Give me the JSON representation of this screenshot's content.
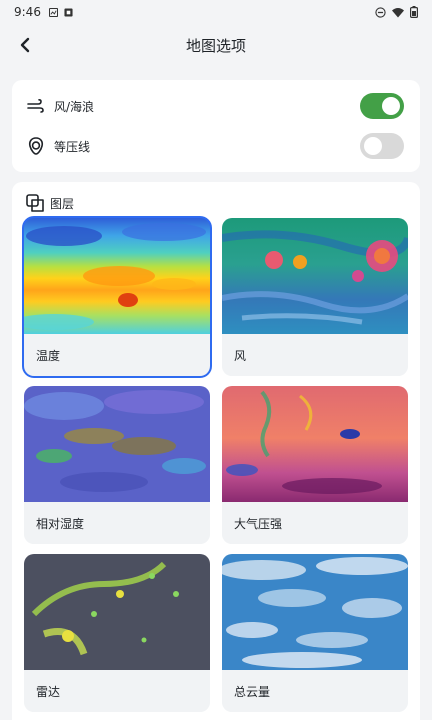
{
  "status_bar": {
    "time": "9:46"
  },
  "header": {
    "title": "地图选项"
  },
  "toggles": [
    {
      "label": "风/海浪",
      "icon": "wind-icon",
      "on": true
    },
    {
      "label": "等压线",
      "icon": "isobar-icon",
      "on": false
    }
  ],
  "layers": {
    "title": "图层",
    "items": [
      {
        "label": "温度",
        "selected": true
      },
      {
        "label": "风",
        "selected": false
      },
      {
        "label": "相对湿度",
        "selected": false
      },
      {
        "label": "大气压强",
        "selected": false
      },
      {
        "label": "雷达",
        "selected": false
      },
      {
        "label": "总云量",
        "selected": false
      }
    ]
  },
  "colors": {
    "accent": "#2f6bf0",
    "toggle_on": "#43a047",
    "toggle_off": "#d9d9d9"
  }
}
